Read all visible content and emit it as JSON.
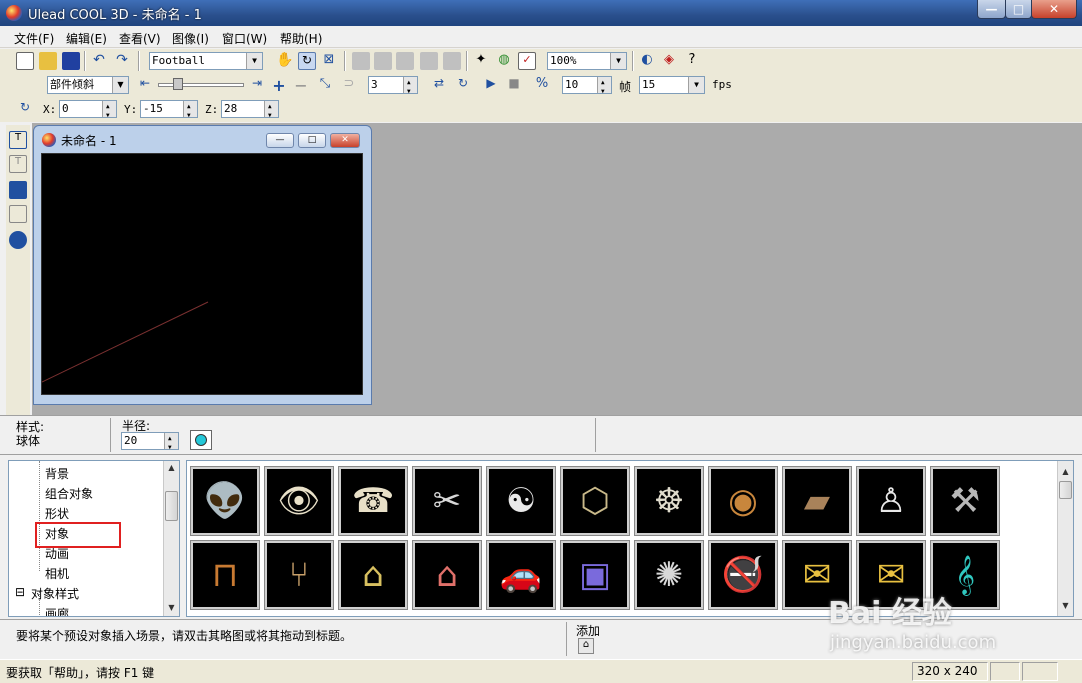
{
  "window": {
    "title": "Ulead COOL 3D - 未命名 - 1",
    "min_label": "—",
    "max_label": "□",
    "close_label": "✕"
  },
  "menu": {
    "items": [
      "文件(F)",
      "编辑(E)",
      "查看(V)",
      "图像(I)",
      "窗口(W)",
      "帮助(H)"
    ]
  },
  "toolbar1": {
    "font_select": "Football",
    "zoom_select": "100%"
  },
  "toolbar2": {
    "mode_select": "部件倾斜",
    "bevel_value": "3",
    "frame_value": "10",
    "frame_label": "帧",
    "fps_value": "15",
    "fps_label": "fps"
  },
  "toolbar3": {
    "x_label": "X:",
    "x_value": "0",
    "y_label": "Y:",
    "y_value": "-15",
    "z_label": "Z:",
    "z_value": "28"
  },
  "document": {
    "title": "未命名 - 1"
  },
  "property_bar": {
    "style_label": "样式:",
    "style_value": "球体",
    "radius_label": "半径:",
    "radius_value": "20",
    "color": "#25c8d8"
  },
  "tree": {
    "items": [
      {
        "label": "背景"
      },
      {
        "label": "组合对象"
      },
      {
        "label": "形状"
      },
      {
        "label": "对象"
      },
      {
        "label": "动画"
      },
      {
        "label": "相机"
      },
      {
        "label": "对象样式",
        "expander": "⊟"
      },
      {
        "label": "画廊"
      }
    ]
  },
  "gallery": {
    "items": [
      {
        "icon": "alien-face-icon",
        "glyph": "👽",
        "color": "#c9c9c9"
      },
      {
        "icon": "eye-icon",
        "glyph": "👁",
        "color": "#e8e0c8"
      },
      {
        "icon": "telephone-icon",
        "glyph": "☎",
        "color": "#e8e0c8"
      },
      {
        "icon": "scissors-icon",
        "glyph": "✂",
        "color": "#d8d8d8"
      },
      {
        "icon": "yin-yang-icon",
        "glyph": "☯",
        "color": "#e8e8e8"
      },
      {
        "icon": "medallion-icon",
        "glyph": "⬡",
        "color": "#c9b98a"
      },
      {
        "icon": "steering-wheel-icon",
        "glyph": "☸",
        "color": "#e0dccd"
      },
      {
        "icon": "donut-icon",
        "glyph": "◉",
        "color": "#c8863c"
      },
      {
        "icon": "bread-icon",
        "glyph": "▰",
        "color": "#a8825a"
      },
      {
        "icon": "bowling-pin-icon",
        "glyph": "♙",
        "color": "#e8e8e8"
      },
      {
        "icon": "hammer-icon",
        "glyph": "⚒",
        "color": "#b8b8b8"
      },
      {
        "icon": "table-icon",
        "glyph": "⊓",
        "color": "#c87a32"
      },
      {
        "icon": "chair-icon",
        "glyph": "⑂",
        "color": "#c8a06a"
      },
      {
        "icon": "doghouse-icon",
        "glyph": "⌂",
        "color": "#d8c060"
      },
      {
        "icon": "house-icon",
        "glyph": "⌂",
        "color": "#e0706a"
      },
      {
        "icon": "car-icon",
        "glyph": "🚗",
        "color": "#e06a6a"
      },
      {
        "icon": "floppy-disk-icon",
        "glyph": "▣",
        "color": "#7a6adc"
      },
      {
        "icon": "spider-web-icon",
        "glyph": "✺",
        "color": "#d8d8d8"
      },
      {
        "icon": "no-smoking-icon",
        "glyph": "🚭",
        "color": "#e02020"
      },
      {
        "icon": "mailbox-icon",
        "glyph": "✉",
        "color": "#e8c040"
      },
      {
        "icon": "mailbox-pair-icon",
        "glyph": "✉",
        "color": "#e8c040"
      },
      {
        "icon": "treble-clef-icon",
        "glyph": "𝄞",
        "color": "#30c8c0"
      }
    ]
  },
  "hint": {
    "text": "要将某个预设对象插入场景，请双击其略图或将其拖动到标题。",
    "add_label": "添加"
  },
  "status": {
    "help_text": "要获取「帮助」，请按 F1 键",
    "dimensions": "320 x 240"
  },
  "watermark": {
    "text": "Bai 经验",
    "url": "jingyan.baidu.com"
  }
}
